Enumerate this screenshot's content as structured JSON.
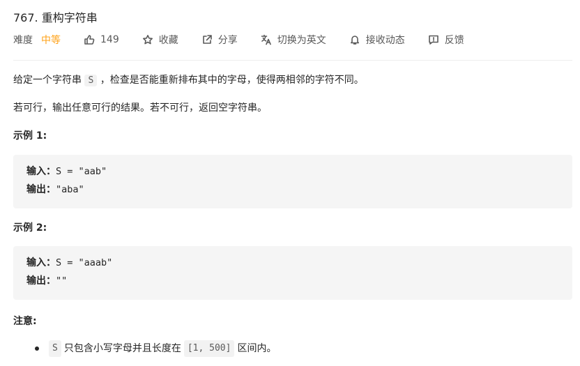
{
  "problem": {
    "title": "767. 重构字符串"
  },
  "meta": {
    "difficulty_label": "难度",
    "difficulty_value": "中等",
    "likes": "149",
    "favorite_label": "收藏",
    "share_label": "分享",
    "switch_lang_label": "切换为英文",
    "notify_label": "接收动态",
    "feedback_label": "反馈",
    "difficulty_color": "#ffa116"
  },
  "description": {
    "p1_before": "给定一个字符串",
    "p1_code": "S",
    "p1_after": "，检查是否能重新排布其中的字母，使得两相邻的字符不同。",
    "p2": "若可行，输出任意可行的结果。若不可行，返回空字符串。"
  },
  "example1": {
    "title": "示例 1:",
    "input_label": "输入：",
    "input_value": "S = \"aab\"",
    "output_label": "输出：",
    "output_value": "\"aba\""
  },
  "example2": {
    "title": "示例 2:",
    "input_label": "输入：",
    "input_value": "S = \"aaab\"",
    "output_label": "输出：",
    "output_value": "\"\""
  },
  "note": {
    "title": "注意:",
    "code1": "S",
    "text1": "只包含小写字母并且长度在",
    "code2": "[1, 500]",
    "text2": "区间内。"
  },
  "icons": {
    "like": "thumbs-up-icon",
    "favorite": "star-icon",
    "share": "share-icon",
    "translate": "translate-icon",
    "notify": "bell-icon",
    "feedback": "feedback-icon"
  }
}
